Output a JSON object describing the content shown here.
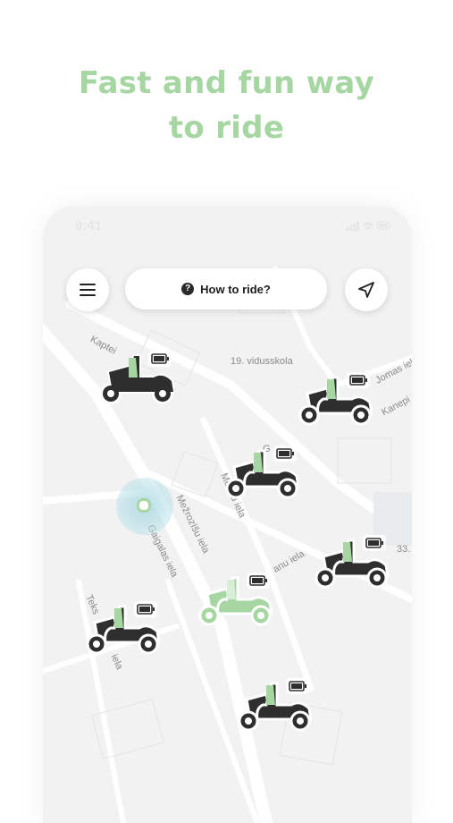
{
  "headline": {
    "line1": "Fast and fun way",
    "line2": "to ride"
  },
  "status_bar": {
    "time": "9:41"
  },
  "toolbar": {
    "how_to_ride_label": "How to ride?",
    "help_glyph": "?"
  },
  "map_labels": {
    "kapteinu": "Kaptei",
    "school": "19. vidusskola",
    "jomas": "Jomas iela",
    "kanepes": "Kanepi",
    "g": "G",
    "mencu": "Menču iela",
    "mezrozisu": "Mežrozīšu iela",
    "gaigalas": "Gaigalas iela",
    "anu": "anu iela",
    "n33": "33.",
    "teks": "Teks",
    "iela": "iela"
  },
  "colors": {
    "accent_green": "#a6d6a2",
    "scooter_body": "#2e2e2e",
    "map_bg": "#f2f2f2",
    "road": "#ffffff"
  },
  "icons": {
    "menu": "hamburger-menu-icon",
    "help": "question-circle-icon",
    "locate": "navigation-arrow-icon",
    "battery": "battery-full-icon"
  }
}
